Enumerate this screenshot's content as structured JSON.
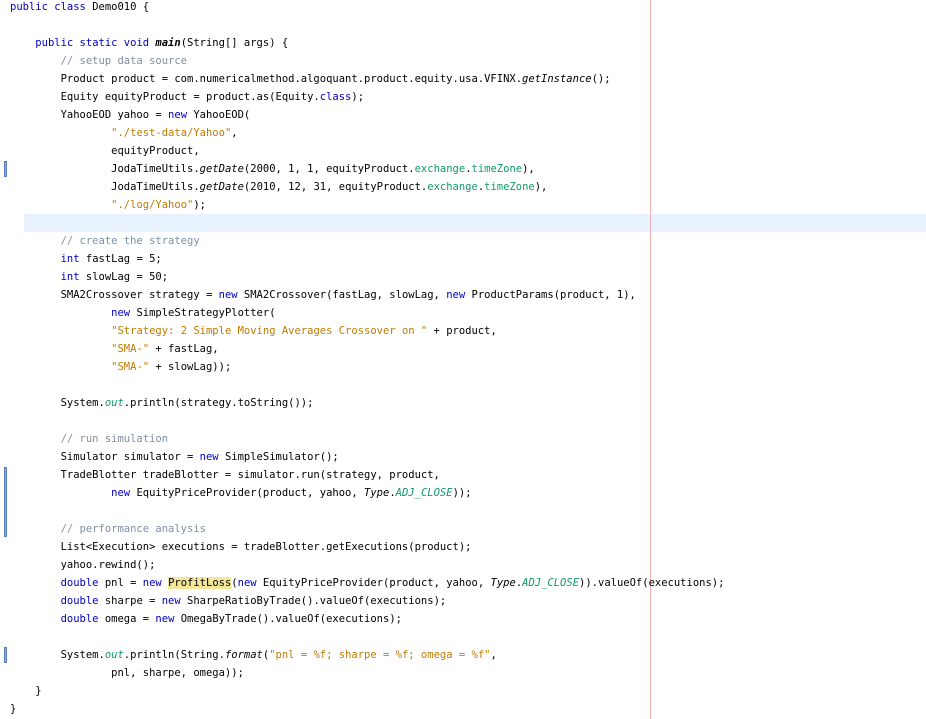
{
  "editor": {
    "lines": [
      [
        {
          "t": "public class ",
          "c": "kw"
        },
        {
          "t": "Demo010 {"
        }
      ],
      [],
      [
        {
          "t": "    "
        },
        {
          "t": "public static void ",
          "c": "kw"
        },
        {
          "t": "main",
          "c": "bi"
        },
        {
          "t": "(String[] args) {"
        }
      ],
      [
        {
          "t": "        "
        },
        {
          "t": "// setup data source",
          "c": "cm"
        }
      ],
      [
        {
          "t": "        Product product = com.numericalmethod.algoquant.product.equity.usa.VFINX."
        },
        {
          "t": "getInstance",
          "c": "it"
        },
        {
          "t": "();"
        }
      ],
      [
        {
          "t": "        Equity equityProduct = product.as(Equity."
        },
        {
          "t": "class",
          "c": "kw"
        },
        {
          "t": ");"
        }
      ],
      [
        {
          "t": "        YahooEOD yahoo = "
        },
        {
          "t": "new",
          "c": "kw"
        },
        {
          "t": " YahooEOD("
        }
      ],
      [
        {
          "t": "                "
        },
        {
          "t": "\"./test-data/Yahoo\"",
          "c": "str"
        },
        {
          "t": ","
        }
      ],
      [
        {
          "t": "                equityProduct,"
        }
      ],
      [
        {
          "t": "                JodaTimeUtils."
        },
        {
          "t": "getDate",
          "c": "it"
        },
        {
          "t": "(2000, 1, 1, equityProduct."
        },
        {
          "t": "exchange",
          "c": "fld"
        },
        {
          "t": "."
        },
        {
          "t": "timeZone",
          "c": "fld"
        },
        {
          "t": "),"
        }
      ],
      [
        {
          "t": "                JodaTimeUtils."
        },
        {
          "t": "getDate",
          "c": "it"
        },
        {
          "t": "(2010, 12, 31, equityProduct."
        },
        {
          "t": "exchange",
          "c": "fld"
        },
        {
          "t": "."
        },
        {
          "t": "timeZone",
          "c": "fld"
        },
        {
          "t": "),"
        }
      ],
      [
        {
          "t": "                "
        },
        {
          "t": "\"./log/Yahoo\"",
          "c": "str"
        },
        {
          "t": ");"
        }
      ],
      [],
      [
        {
          "t": "        "
        },
        {
          "t": "// create the strategy",
          "c": "cm"
        }
      ],
      [
        {
          "t": "        "
        },
        {
          "t": "int",
          "c": "kw"
        },
        {
          "t": " fastLag = 5;"
        }
      ],
      [
        {
          "t": "        "
        },
        {
          "t": "int",
          "c": "kw"
        },
        {
          "t": " slowLag = 50;"
        }
      ],
      [
        {
          "t": "        SMA2Crossover strategy = "
        },
        {
          "t": "new",
          "c": "kw"
        },
        {
          "t": " SMA2Crossover(fastLag, slowLag, "
        },
        {
          "t": "new",
          "c": "kw"
        },
        {
          "t": " ProductParams(product, 1),"
        }
      ],
      [
        {
          "t": "                "
        },
        {
          "t": "new",
          "c": "kw"
        },
        {
          "t": " SimpleStrategyPlotter("
        }
      ],
      [
        {
          "t": "                "
        },
        {
          "t": "\"Strategy: 2 Simple Moving Averages Crossover on \"",
          "c": "str"
        },
        {
          "t": " + product,"
        }
      ],
      [
        {
          "t": "                "
        },
        {
          "t": "\"SMA-\"",
          "c": "str"
        },
        {
          "t": " + fastLag,"
        }
      ],
      [
        {
          "t": "                "
        },
        {
          "t": "\"SMA-\"",
          "c": "str"
        },
        {
          "t": " + slowLag));"
        }
      ],
      [],
      [
        {
          "t": "        System."
        },
        {
          "t": "out",
          "c": "cst"
        },
        {
          "t": ".println(strategy.toString());"
        }
      ],
      [],
      [
        {
          "t": "        "
        },
        {
          "t": "// run simulation",
          "c": "cm"
        }
      ],
      [
        {
          "t": "        Simulator simulator = "
        },
        {
          "t": "new",
          "c": "kw"
        },
        {
          "t": " SimpleSimulator();"
        }
      ],
      [
        {
          "t": "        TradeBlotter tradeBlotter = simulator.run(strategy, product,"
        }
      ],
      [
        {
          "t": "                "
        },
        {
          "t": "new",
          "c": "kw"
        },
        {
          "t": " EquityPriceProvider(product, yahoo, "
        },
        {
          "t": "Type",
          "c": "it"
        },
        {
          "t": "."
        },
        {
          "t": "ADJ_CLOSE",
          "c": "cst"
        },
        {
          "t": "));"
        }
      ],
      [],
      [
        {
          "t": "        "
        },
        {
          "t": "// performance analysis",
          "c": "cm"
        }
      ],
      [
        {
          "t": "        List<Execution> executions = tradeBlotter.getExecutions(product);"
        }
      ],
      [
        {
          "t": "        yahoo.rewind();"
        }
      ],
      [
        {
          "t": "        "
        },
        {
          "t": "double",
          "c": "kw"
        },
        {
          "t": " pnl = "
        },
        {
          "t": "new",
          "c": "kw"
        },
        {
          "t": " "
        },
        {
          "t": "ProfitLoss",
          "c": "hl"
        },
        {
          "t": "("
        },
        {
          "t": "new",
          "c": "kw"
        },
        {
          "t": " EquityPriceProvider(product, yahoo, "
        },
        {
          "t": "Type",
          "c": "it"
        },
        {
          "t": "."
        },
        {
          "t": "ADJ_CLOSE",
          "c": "cst"
        },
        {
          "t": ")).valueOf(executions);"
        }
      ],
      [
        {
          "t": "        "
        },
        {
          "t": "double",
          "c": "kw"
        },
        {
          "t": " sharpe = "
        },
        {
          "t": "new",
          "c": "kw"
        },
        {
          "t": " SharpeRatioByTrade().valueOf(executions);"
        }
      ],
      [
        {
          "t": "        "
        },
        {
          "t": "double",
          "c": "kw"
        },
        {
          "t": " omega = "
        },
        {
          "t": "new",
          "c": "kw"
        },
        {
          "t": " OmegaByTrade().valueOf(executions);"
        }
      ],
      [],
      [
        {
          "t": "        System."
        },
        {
          "t": "out",
          "c": "cst"
        },
        {
          "t": ".println(String."
        },
        {
          "t": "format",
          "c": "it"
        },
        {
          "t": "("
        },
        {
          "t": "\"pnl = %f; sharpe = %f; omega = %f\"",
          "c": "str"
        },
        {
          "t": ","
        }
      ],
      [
        {
          "t": "                pnl, sharpe, omega));"
        }
      ],
      [
        {
          "t": "    }"
        }
      ],
      [
        {
          "t": "}"
        }
      ]
    ],
    "current_line": 12,
    "change_markers": [
      [
        9,
        9
      ],
      [
        26,
        29
      ],
      [
        36,
        36
      ]
    ],
    "colors": {
      "keyword": "#0000c0",
      "string": "#c07a00",
      "comment": "#7f8fa4",
      "field": "#119a6a",
      "highlight": "#f4e79a",
      "current_line": "#e8f2fe",
      "print_margin": "#f0b4b4"
    }
  }
}
